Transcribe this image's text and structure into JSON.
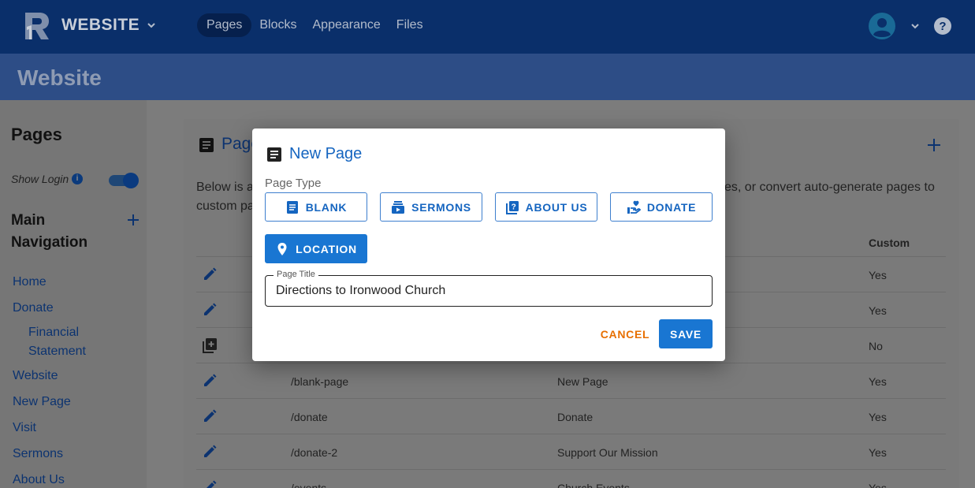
{
  "header": {
    "brand": "WEBSITE",
    "tabs": [
      {
        "label": "Pages",
        "active": true
      },
      {
        "label": "Blocks",
        "active": false
      },
      {
        "label": "Appearance",
        "active": false
      },
      {
        "label": "Files",
        "active": false
      }
    ]
  },
  "subheader": {
    "title": "Website"
  },
  "sidebar": {
    "title": "Pages",
    "show_login_label": "Show Login",
    "show_login_enabled": true,
    "main_nav_title": "Main Navigation",
    "items": [
      {
        "label": "Home"
      },
      {
        "label": "Donate"
      },
      {
        "label": "Financial Statement"
      },
      {
        "label": "Website"
      },
      {
        "label": "New Page"
      },
      {
        "label": "Visit"
      },
      {
        "label": "Sermons"
      },
      {
        "label": "About Us"
      }
    ]
  },
  "card": {
    "title": "Page",
    "desc_left": "Below is a",
    "desc_left2": "custom pa",
    "desc_right": "es, or convert auto-generate pages to",
    "column_custom": "Custom",
    "rows": [
      {
        "icon": "edit-icon",
        "path": "",
        "title": "",
        "custom": "Yes"
      },
      {
        "icon": "edit-icon",
        "path": "",
        "title": "",
        "custom": "Yes"
      },
      {
        "icon": "convert-page-icon",
        "path": "",
        "title": "",
        "custom": "No"
      },
      {
        "icon": "edit-icon",
        "path": "/blank-page",
        "title": "New Page",
        "custom": "Yes"
      },
      {
        "icon": "edit-icon",
        "path": "/donate",
        "title": "Donate",
        "custom": "Yes"
      },
      {
        "icon": "edit-icon",
        "path": "/donate-2",
        "title": "Support Our Mission",
        "custom": "Yes"
      },
      {
        "icon": "edit-icon",
        "path": "/events",
        "title": "Church Events",
        "custom": "Yes"
      }
    ]
  },
  "modal": {
    "title": "New Page",
    "page_type_label": "Page Type",
    "page_types": [
      "BLANK",
      "SERMONS",
      "ABOUT US",
      "DONATE",
      "LOCATION"
    ],
    "selected_page_type": "LOCATION",
    "page_title_label": "Page Title",
    "page_title_value": "Directions to Ironwood Church",
    "cancel_label": "CANCEL",
    "save_label": "SAVE"
  },
  "colors": {
    "primary": "#1976d2",
    "cancel": "#e76f00",
    "header_bg": "#0a2f6a"
  }
}
